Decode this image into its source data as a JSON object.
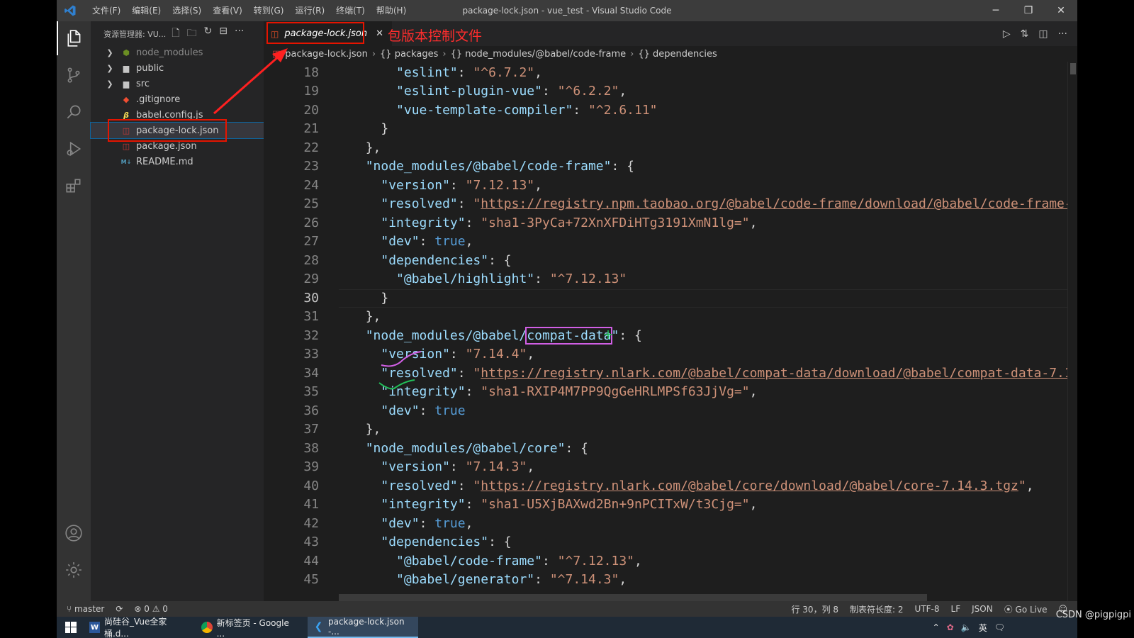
{
  "titlebar": {
    "menu": [
      "文件(F)",
      "编辑(E)",
      "选择(S)",
      "查看(V)",
      "转到(G)",
      "运行(R)",
      "终端(T)",
      "帮助(H)"
    ],
    "title": "package-lock.json - vue_test - Visual Studio Code",
    "minimize": "─",
    "maximize": "❐",
    "close": "✕"
  },
  "sidebar": {
    "header": "资源管理器: VU...",
    "items": [
      {
        "label": "node_modules",
        "type": "folder",
        "icon": "node-folder-icon"
      },
      {
        "label": "public",
        "type": "folder",
        "icon": "folder-icon"
      },
      {
        "label": "src",
        "type": "folder",
        "icon": "folder-icon"
      },
      {
        "label": ".gitignore",
        "type": "file",
        "icon": "git-icon"
      },
      {
        "label": "babel.config.js",
        "type": "file",
        "icon": "babel-icon"
      },
      {
        "label": "package-lock.json",
        "type": "file",
        "icon": "npm-icon",
        "selected": true
      },
      {
        "label": "package.json",
        "type": "file",
        "icon": "npm-icon"
      },
      {
        "label": "README.md",
        "type": "file",
        "icon": "markdown-icon"
      }
    ]
  },
  "editor": {
    "tab": {
      "label": "package-lock.json",
      "close": "✕"
    },
    "annotation": "包版本控制文件",
    "breadcrumb": [
      "package-lock.json",
      "{} packages",
      "{} node_modules/@babel/code-frame",
      "{} dependencies"
    ],
    "current_line": 30
  },
  "statusbar": {
    "branch": "master",
    "problems": "⊗ 0 ⚠ 0",
    "position": "行 30，列 8",
    "tab_size": "制表符长度: 2",
    "encoding": "UTF-8",
    "eol": "LF",
    "language": "JSON",
    "golive": "Go Live"
  },
  "taskbar": {
    "items": [
      {
        "label": "尚硅谷_Vue全家桶.d...",
        "icon": "word-icon"
      },
      {
        "label": "新标签页 - Google ...",
        "icon": "chrome-icon"
      },
      {
        "label": "package-lock.json -...",
        "icon": "vscode-icon",
        "active": true
      }
    ],
    "ime": "英",
    "watermark": "CSDN @pigpigpi"
  },
  "colors": {
    "key": "#9cdcfe",
    "string": "#ce9178",
    "boolean": "#569cd6",
    "annotation_red": "#e51400",
    "highlight_purple": "#d15fe5"
  }
}
